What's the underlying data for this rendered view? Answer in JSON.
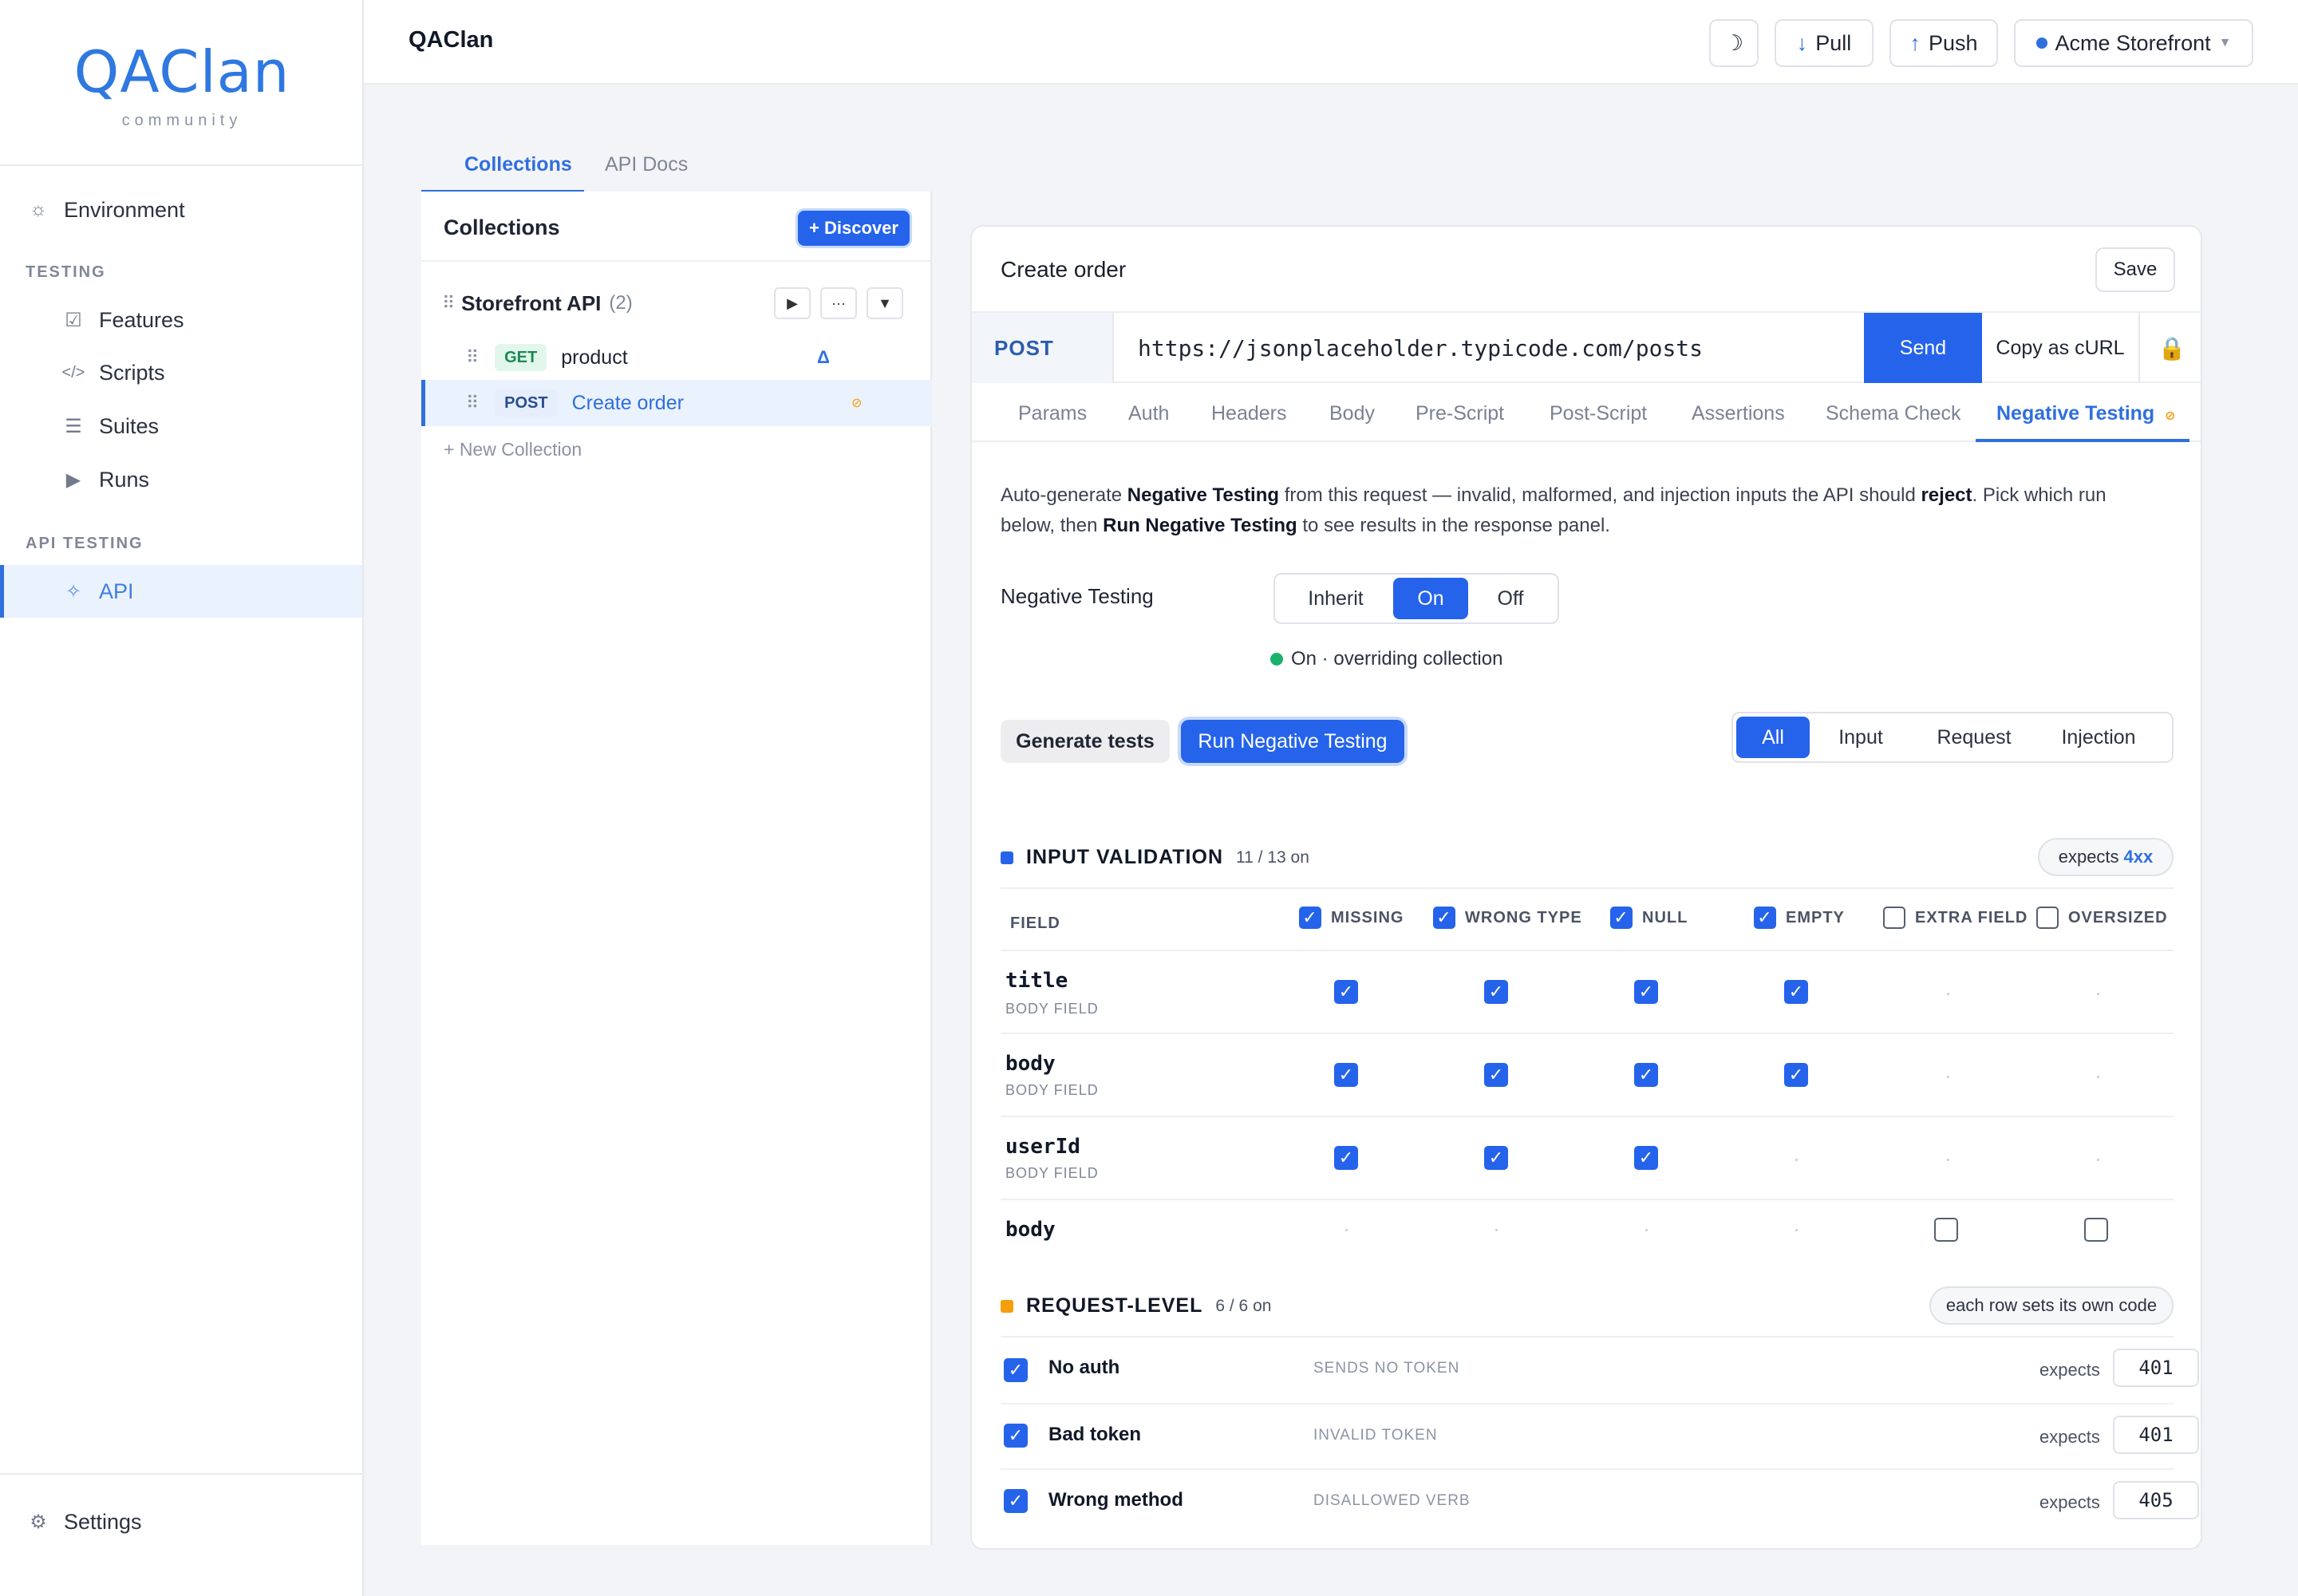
{
  "brand": {
    "logo": "QAClan",
    "tagline": "community"
  },
  "sidebar": {
    "environment": "Environment",
    "sections": {
      "testing": "TESTING",
      "api_testing": "API TESTING"
    },
    "items": {
      "features": "Features",
      "scripts": "Scripts",
      "suites": "Suites",
      "runs": "Runs",
      "api": "API"
    },
    "settings": "Settings"
  },
  "topbar": {
    "title": "QAClan",
    "theme_icon": "☽",
    "pull": "Pull",
    "push": "Push",
    "environment": "Acme Storefront"
  },
  "left_tabs": {
    "collections": "Collections",
    "api_docs": "API Docs"
  },
  "collections": {
    "title": "Collections",
    "discover": "+ Discover",
    "group": {
      "name": "Storefront API",
      "count": "(2)"
    },
    "requests": [
      {
        "method": "GET",
        "name": "product"
      },
      {
        "method": "POST",
        "name": "Create order"
      }
    ],
    "new_collection": "+ New Collection"
  },
  "request": {
    "title": "Create order",
    "save": "Save",
    "method": "POST",
    "url": "https://jsonplaceholder.typicode.com/posts",
    "send": "Send",
    "copy_curl": "Copy as cURL",
    "tabs": [
      "Params",
      "Auth",
      "Headers",
      "Body",
      "Pre-Script",
      "Post-Script",
      "Assertions",
      "Schema Check",
      "Negative Testing"
    ]
  },
  "negative": {
    "desc": {
      "p1": "Auto-generate ",
      "b1": "Negative Testing",
      "p2": " from this request — invalid, malformed, and injection inputs the API should ",
      "b2": "reject",
      "p3": ". Pick which run below, then ",
      "b3": "Run Negative Testing",
      "p4": " to see results in the response panel."
    },
    "label": "Negative Testing",
    "modes": [
      "Inherit",
      "On",
      "Off"
    ],
    "status": "On · overriding collection",
    "generate": "Generate tests",
    "run": "Run Negative Testing",
    "filters": [
      "All",
      "Input",
      "Request",
      "Injection"
    ],
    "input_validation": {
      "title": "INPUT VALIDATION",
      "count": "11 / 13 on",
      "expects_label": "expects",
      "expects_code": "4xx",
      "field_header": "FIELD",
      "columns": [
        "MISSING",
        "WRONG TYPE",
        "NULL",
        "EMPTY",
        "EXTRA FIELD",
        "OVERSIZED"
      ],
      "rows": [
        {
          "name": "title",
          "sub": "BODY FIELD"
        },
        {
          "name": "body",
          "sub": "BODY FIELD"
        },
        {
          "name": "userId",
          "sub": "BODY FIELD"
        },
        {
          "name": "body",
          "sub": ""
        }
      ]
    },
    "request_level": {
      "title": "REQUEST-LEVEL",
      "count": "6 / 6 on",
      "note": "each row sets its own code",
      "rows": [
        {
          "name": "No auth",
          "hint": "SENDS NO TOKEN",
          "expects": "expects",
          "code": "401"
        },
        {
          "name": "Bad token",
          "hint": "INVALID TOKEN",
          "expects": "expects",
          "code": "401"
        },
        {
          "name": "Wrong method",
          "hint": "DISALLOWED VERB",
          "expects": "expects",
          "code": "405"
        }
      ]
    }
  },
  "colors": {
    "primary": "#2563eb",
    "input_square": "#2563eb",
    "request_square": "#f59e0b",
    "success": "#1ab36b"
  }
}
